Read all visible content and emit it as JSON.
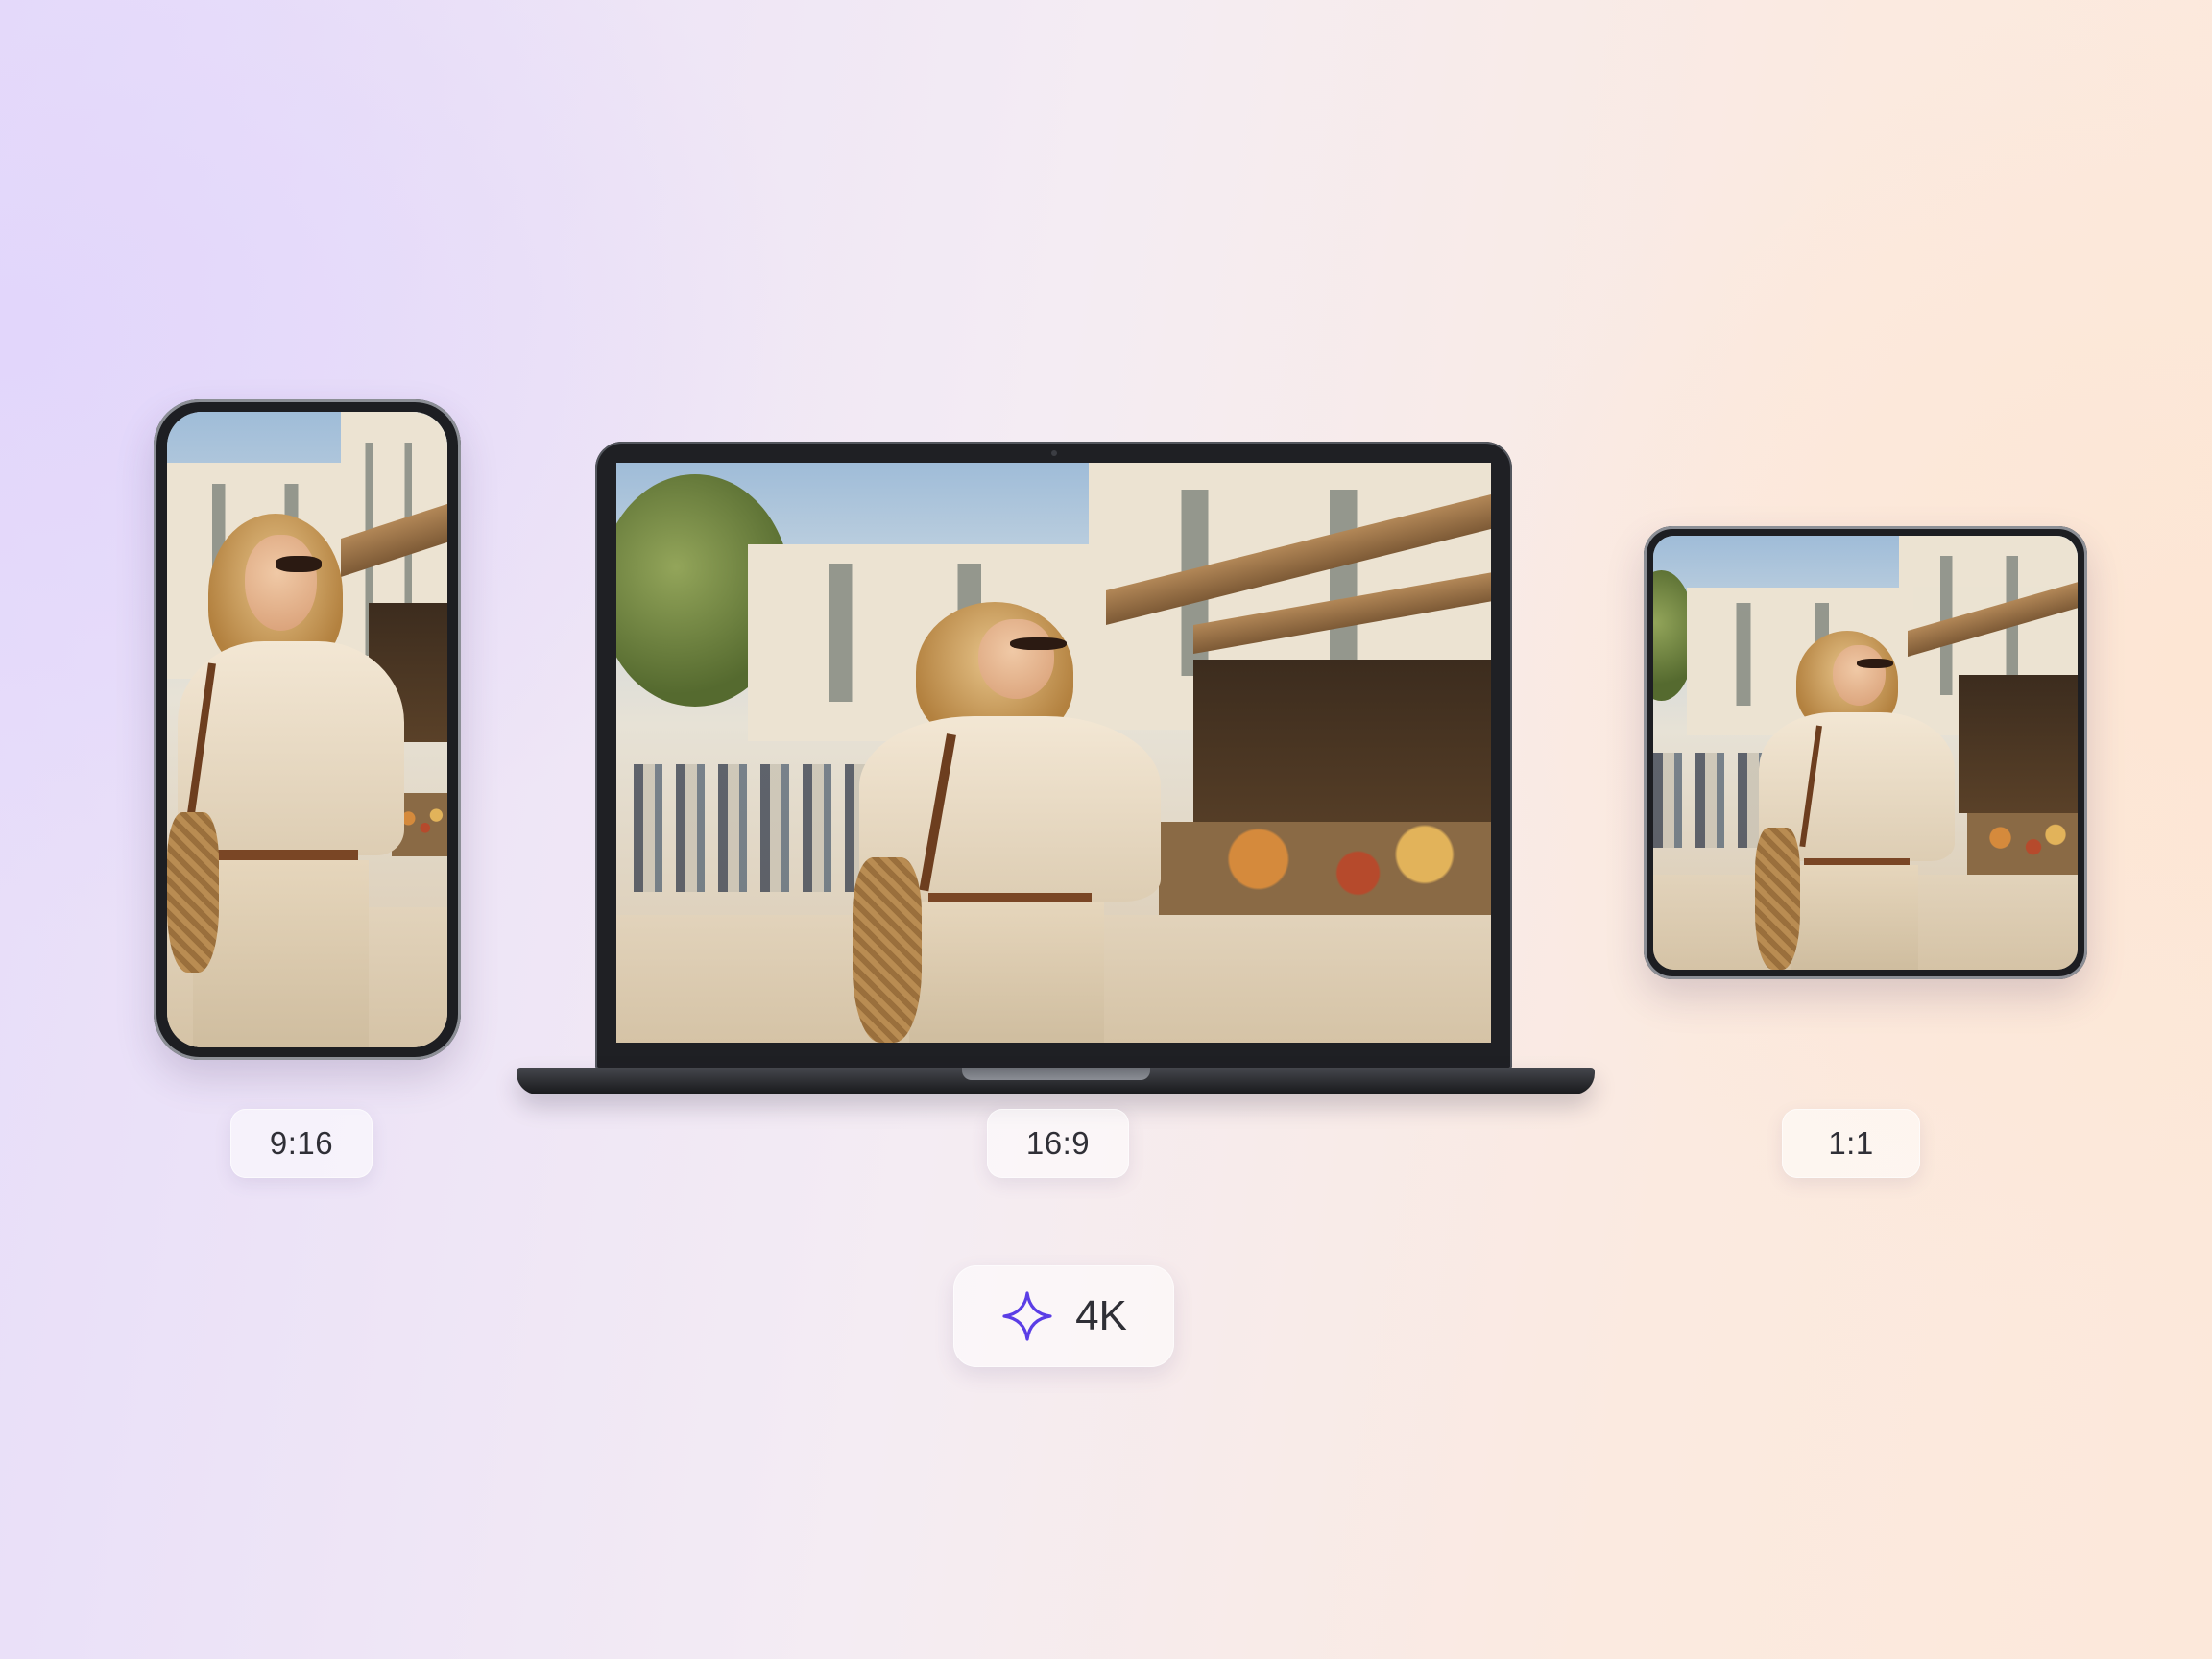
{
  "devices": {
    "phone": {
      "ratio_label": "9:16"
    },
    "laptop": {
      "ratio_label": "16:9"
    },
    "tablet": {
      "ratio_label": "1:1"
    }
  },
  "resolution_badge": {
    "label": "4K",
    "icon": "sparkle-icon"
  },
  "colors": {
    "accent": "#5b3ee6",
    "badge_text": "#2f2f36"
  }
}
